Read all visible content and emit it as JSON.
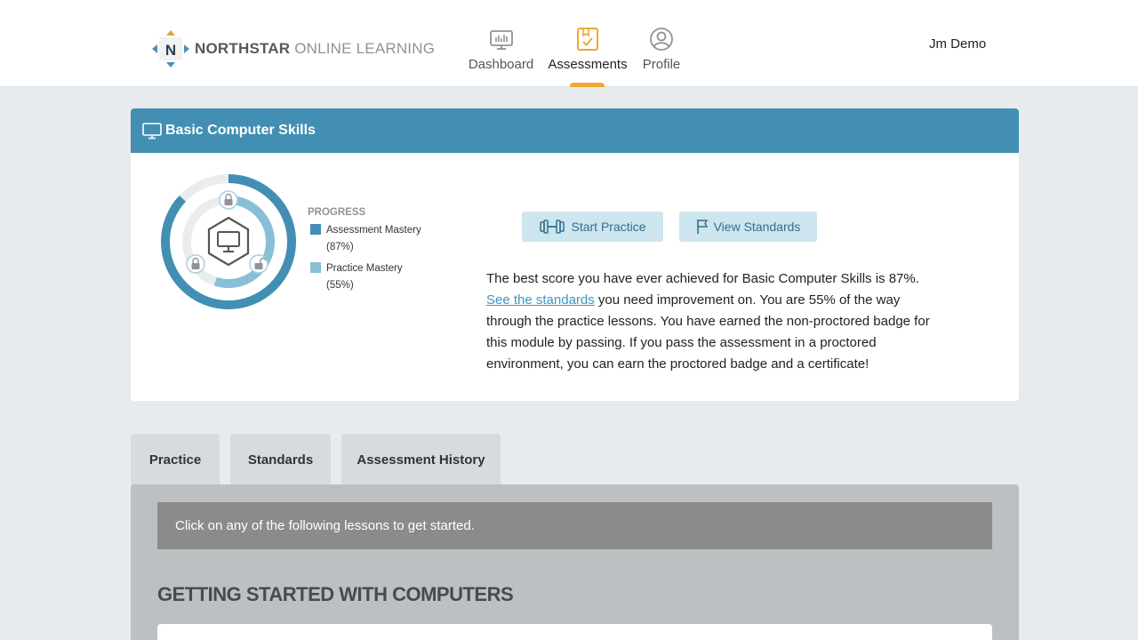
{
  "header": {
    "logo": {
      "brand": "NORTHSTAR",
      "tagline": "ONLINE LEARNING",
      "mark_letter": "N"
    },
    "nav": [
      {
        "label": "Dashboard",
        "icon": "dashboard-monitor-icon",
        "active": false
      },
      {
        "label": "Assessments",
        "icon": "clipboard-check-icon",
        "active": true
      },
      {
        "label": "Profile",
        "icon": "user-circle-icon",
        "active": false
      }
    ],
    "user_name": "Jm Demo"
  },
  "module": {
    "title": "Basic Computer Skills",
    "icon": "monitor-icon",
    "progress": {
      "title": "PROGRESS",
      "assessment_mastery": {
        "label": "Assessment Mastery",
        "value_text": "(87%)",
        "value": 87,
        "color": "#428fb3"
      },
      "practice_mastery": {
        "label": "Practice Mastery",
        "value_text": "(55%)",
        "value": 55,
        "color": "#88bfd6"
      }
    },
    "buttons": {
      "start_practice": "Start Practice",
      "view_standards": "View Standards"
    },
    "summary": {
      "part1": "The best score you have ever achieved for Basic Computer Skills is 87%. ",
      "link": "See the standards",
      "part2": " you need improvement on. You are 55% of the way through the practice lessons. You have earned the non-proctored badge for this module by passing. If you pass the assessment in a proctored environment, you can earn the proctored badge and a certificate!"
    }
  },
  "tabs": [
    {
      "label": "Practice"
    },
    {
      "label": "Standards"
    },
    {
      "label": "Assessment History"
    }
  ],
  "panel": {
    "notice": "Click on any of the following lessons to get started.",
    "section_title": "GETTING STARTED WITH COMPUTERS"
  },
  "colors": {
    "brand_blue": "#428fb3",
    "accent_orange": "#f0a830",
    "light_blue": "#88bfd6"
  }
}
